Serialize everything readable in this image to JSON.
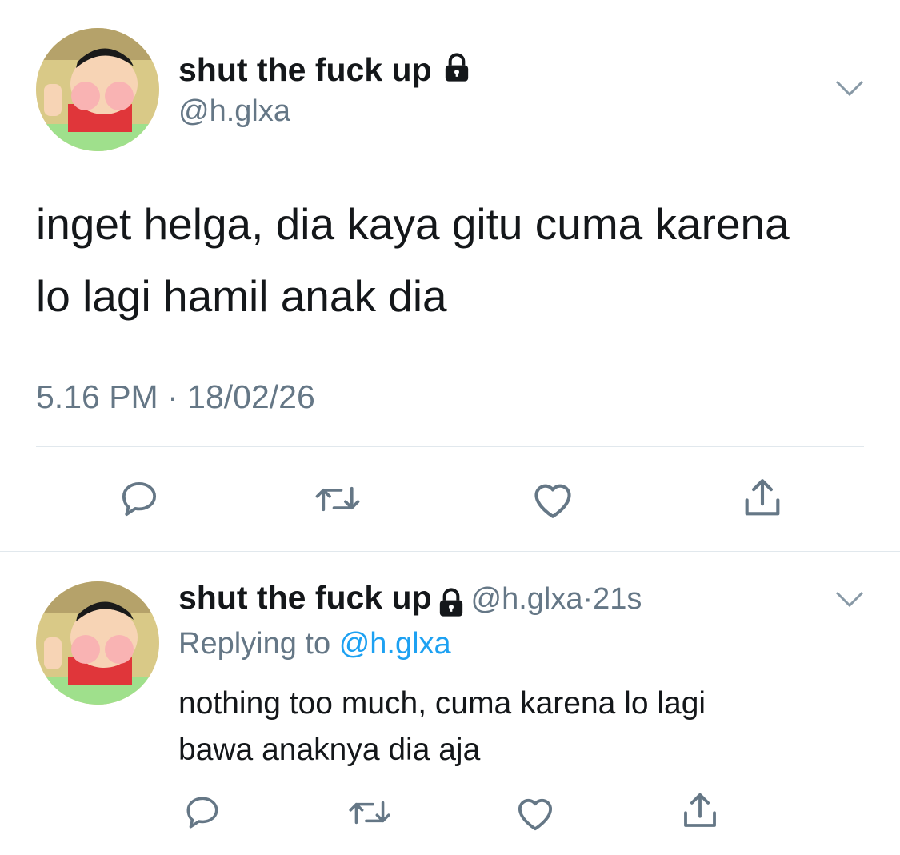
{
  "tweet": {
    "display_name": "shut the fuck up",
    "handle": "@h.glxa",
    "text_line1": "inget helga, dia kaya gitu cuma karena",
    "text_line2": "lo lagi hamil anak dia",
    "time": "5.16 PM",
    "separator": "·",
    "date": "18/02/26"
  },
  "reply": {
    "display_name": "shut the fuck up",
    "handle": "@h.glxa",
    "separator": "·",
    "age": "21s",
    "replying_prefix": "Replying to",
    "replying_to": "@h.glxa",
    "text_line1": "nothing too much, cuma karena lo lagi",
    "text_line2": "bawa anaknya dia aja"
  },
  "icons": [
    "lock-icon",
    "chevron-down-icon",
    "reply-icon",
    "retweet-icon",
    "like-icon",
    "share-icon"
  ],
  "colors": {
    "secondary": "#657786",
    "accent": "#1da1f2",
    "divider": "#e1e8ed"
  }
}
